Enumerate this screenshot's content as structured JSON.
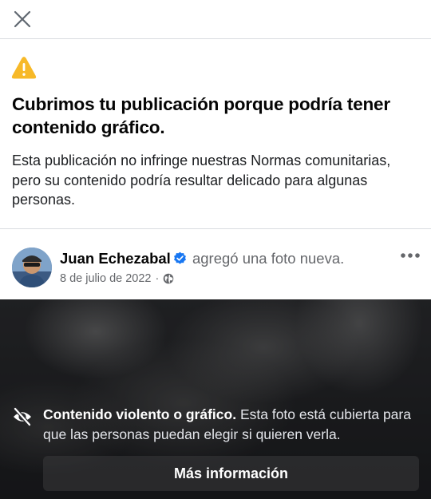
{
  "topbar": {
    "close_icon": "close-icon"
  },
  "warning": {
    "icon": "warning-triangle-icon",
    "icon_color": "#f7b928",
    "title": "Cubrimos tu publicación porque podría tener contenido gráfico.",
    "body": "Esta publicación no infringe nuestras Normas comunitarias, pero su contenido podría resultar delicado para algunas personas."
  },
  "post": {
    "author": "Juan Echezabal",
    "verified_icon": "verified-badge-icon",
    "verified_color": "#1877f2",
    "action": "agregó una foto nueva.",
    "date": "8 de julio de 2022",
    "separator": "·",
    "privacy_icon": "globe-icon",
    "more_icon": "more-options-icon"
  },
  "media": {
    "cover_icon": "eye-off-icon",
    "notice_title": "Contenido violento o gráfico.",
    "notice_body": "Esta foto está cubierta para que las personas puedan elegir si quieren verla.",
    "button_label": "Más información"
  }
}
